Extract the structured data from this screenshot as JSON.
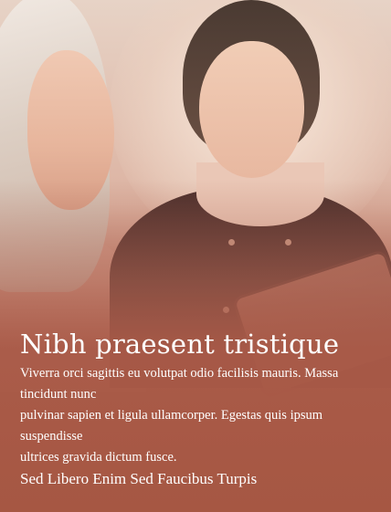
{
  "hero": {
    "title": "Nibh praesent tristique",
    "body_lines": [
      "Viverra orci sagittis eu volutpat odio facilisis mauris. Massa",
      "tincidunt nunc",
      "pulvinar sapien et ligula ullamcorper. Egestas quis ipsum",
      "suspendisse",
      "ultrices gravida dictum fusce."
    ],
    "subtitle": "Sed Libero Enim Sed Faucibus Turpis"
  },
  "colors": {
    "overlay": "#a65743",
    "text": "#ffffff"
  }
}
